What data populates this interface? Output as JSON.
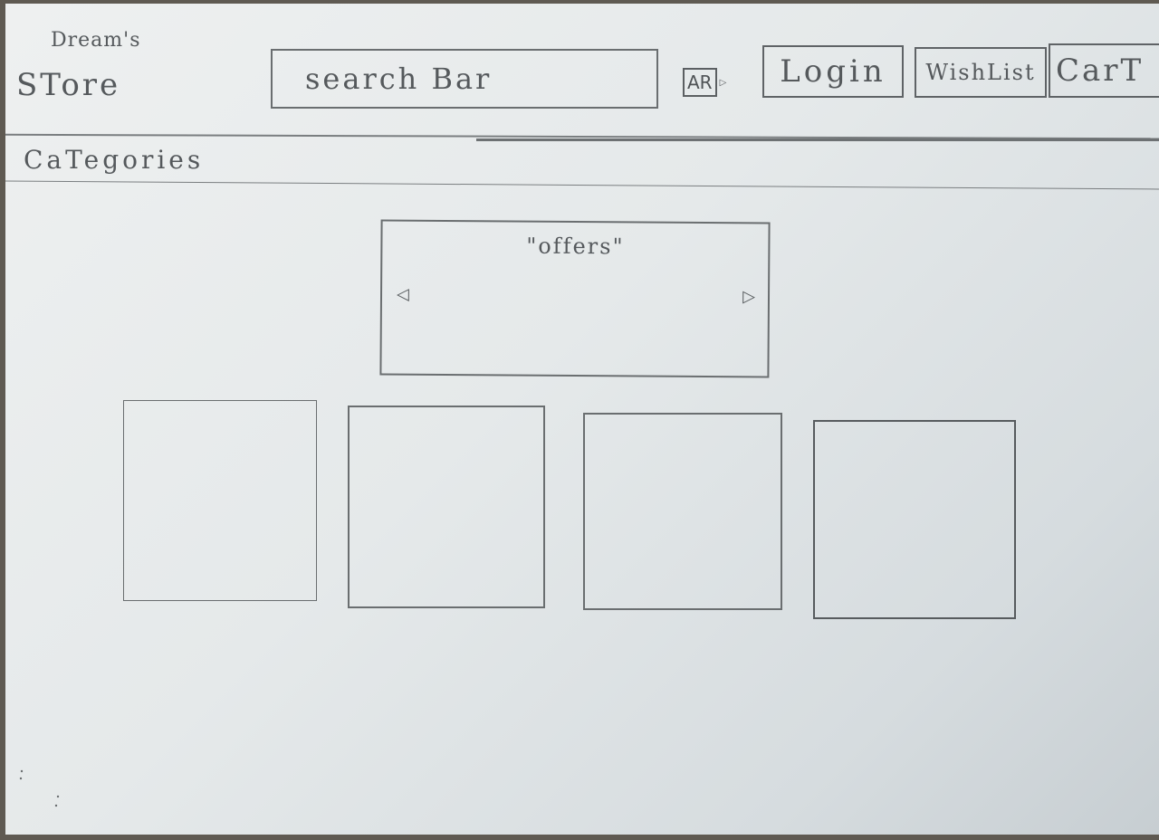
{
  "header": {
    "logo_line1": "Dream's",
    "logo_line2": "STore",
    "search_text": "search Bar",
    "language": "AR",
    "login_label": "Login",
    "wishlist_label": "WishList",
    "cart_label": "CarT"
  },
  "nav": {
    "categories_label": "CaTegories"
  },
  "main": {
    "offers_title": "\"offers\"",
    "prev_icon": "triangle-left-icon",
    "next_icon": "triangle-right-icon",
    "tile_count": 4
  },
  "colors": {
    "paper": "#e5e9ea",
    "pencil": "#55595c",
    "background": "#5f5a52"
  }
}
